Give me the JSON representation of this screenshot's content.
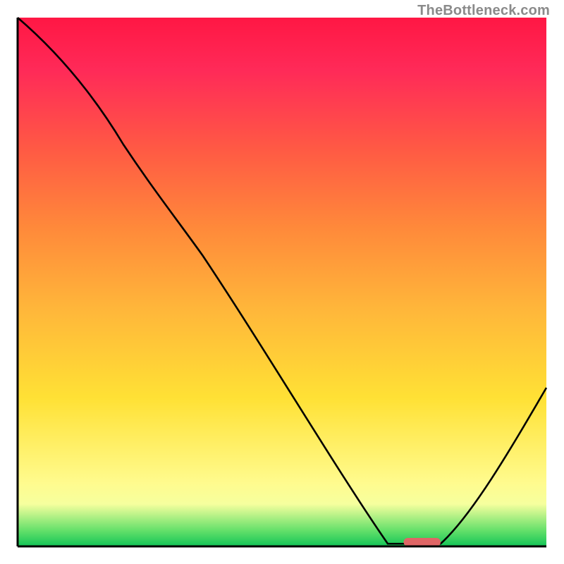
{
  "watermark": "TheBottleneck.com",
  "chart_data": {
    "type": "line",
    "title": "",
    "xlabel": "",
    "ylabel": "",
    "ylim": [
      0,
      100
    ],
    "xlim": [
      0,
      100
    ],
    "series": [
      {
        "name": "curve",
        "points": [
          {
            "x": 0,
            "y": 100
          },
          {
            "x": 20,
            "y": 76
          },
          {
            "x": 35,
            "y": 55
          },
          {
            "x": 55,
            "y": 20
          },
          {
            "x": 70,
            "y": 0
          },
          {
            "x": 75,
            "y": 0
          },
          {
            "x": 80,
            "y": 0
          },
          {
            "x": 100,
            "y": 30
          }
        ],
        "color": "#000000"
      }
    ],
    "marker": {
      "x_start": 73,
      "x_end": 80,
      "y": 0.8,
      "color": "#e06666"
    }
  }
}
